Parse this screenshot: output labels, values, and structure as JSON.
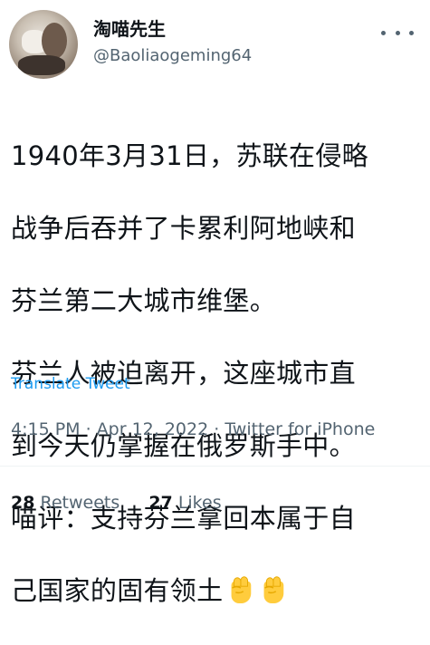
{
  "author": {
    "display_name": "淘喵先生",
    "handle": "@Baoliaogeming64"
  },
  "tweet": {
    "lines": [
      "1940年3月31日，苏联在侵略",
      "战争后吞并了卡累利阿地峡和",
      "芬兰第二大城市维堡。",
      "芬兰人被迫离开，这座城市直",
      "到今天仍掌握在俄罗斯手中。",
      "喵评：支持芬兰拿回本属于自",
      "己国家的固有领土"
    ],
    "emojis": [
      "fist-emoji",
      "fist-emoji"
    ]
  },
  "translate_label": "Translate Tweet",
  "meta": "4:15 PM · Apr 12, 2022 · Twitter for iPhone",
  "stats": {
    "retweets_count": "28",
    "retweets_label": "Retweets",
    "likes_count": "27",
    "likes_label": "Likes"
  },
  "colors": {
    "link": "#1d9bf0",
    "text": "#0f1419",
    "secondary": "#536471",
    "emoji": "#ffcc3d"
  }
}
